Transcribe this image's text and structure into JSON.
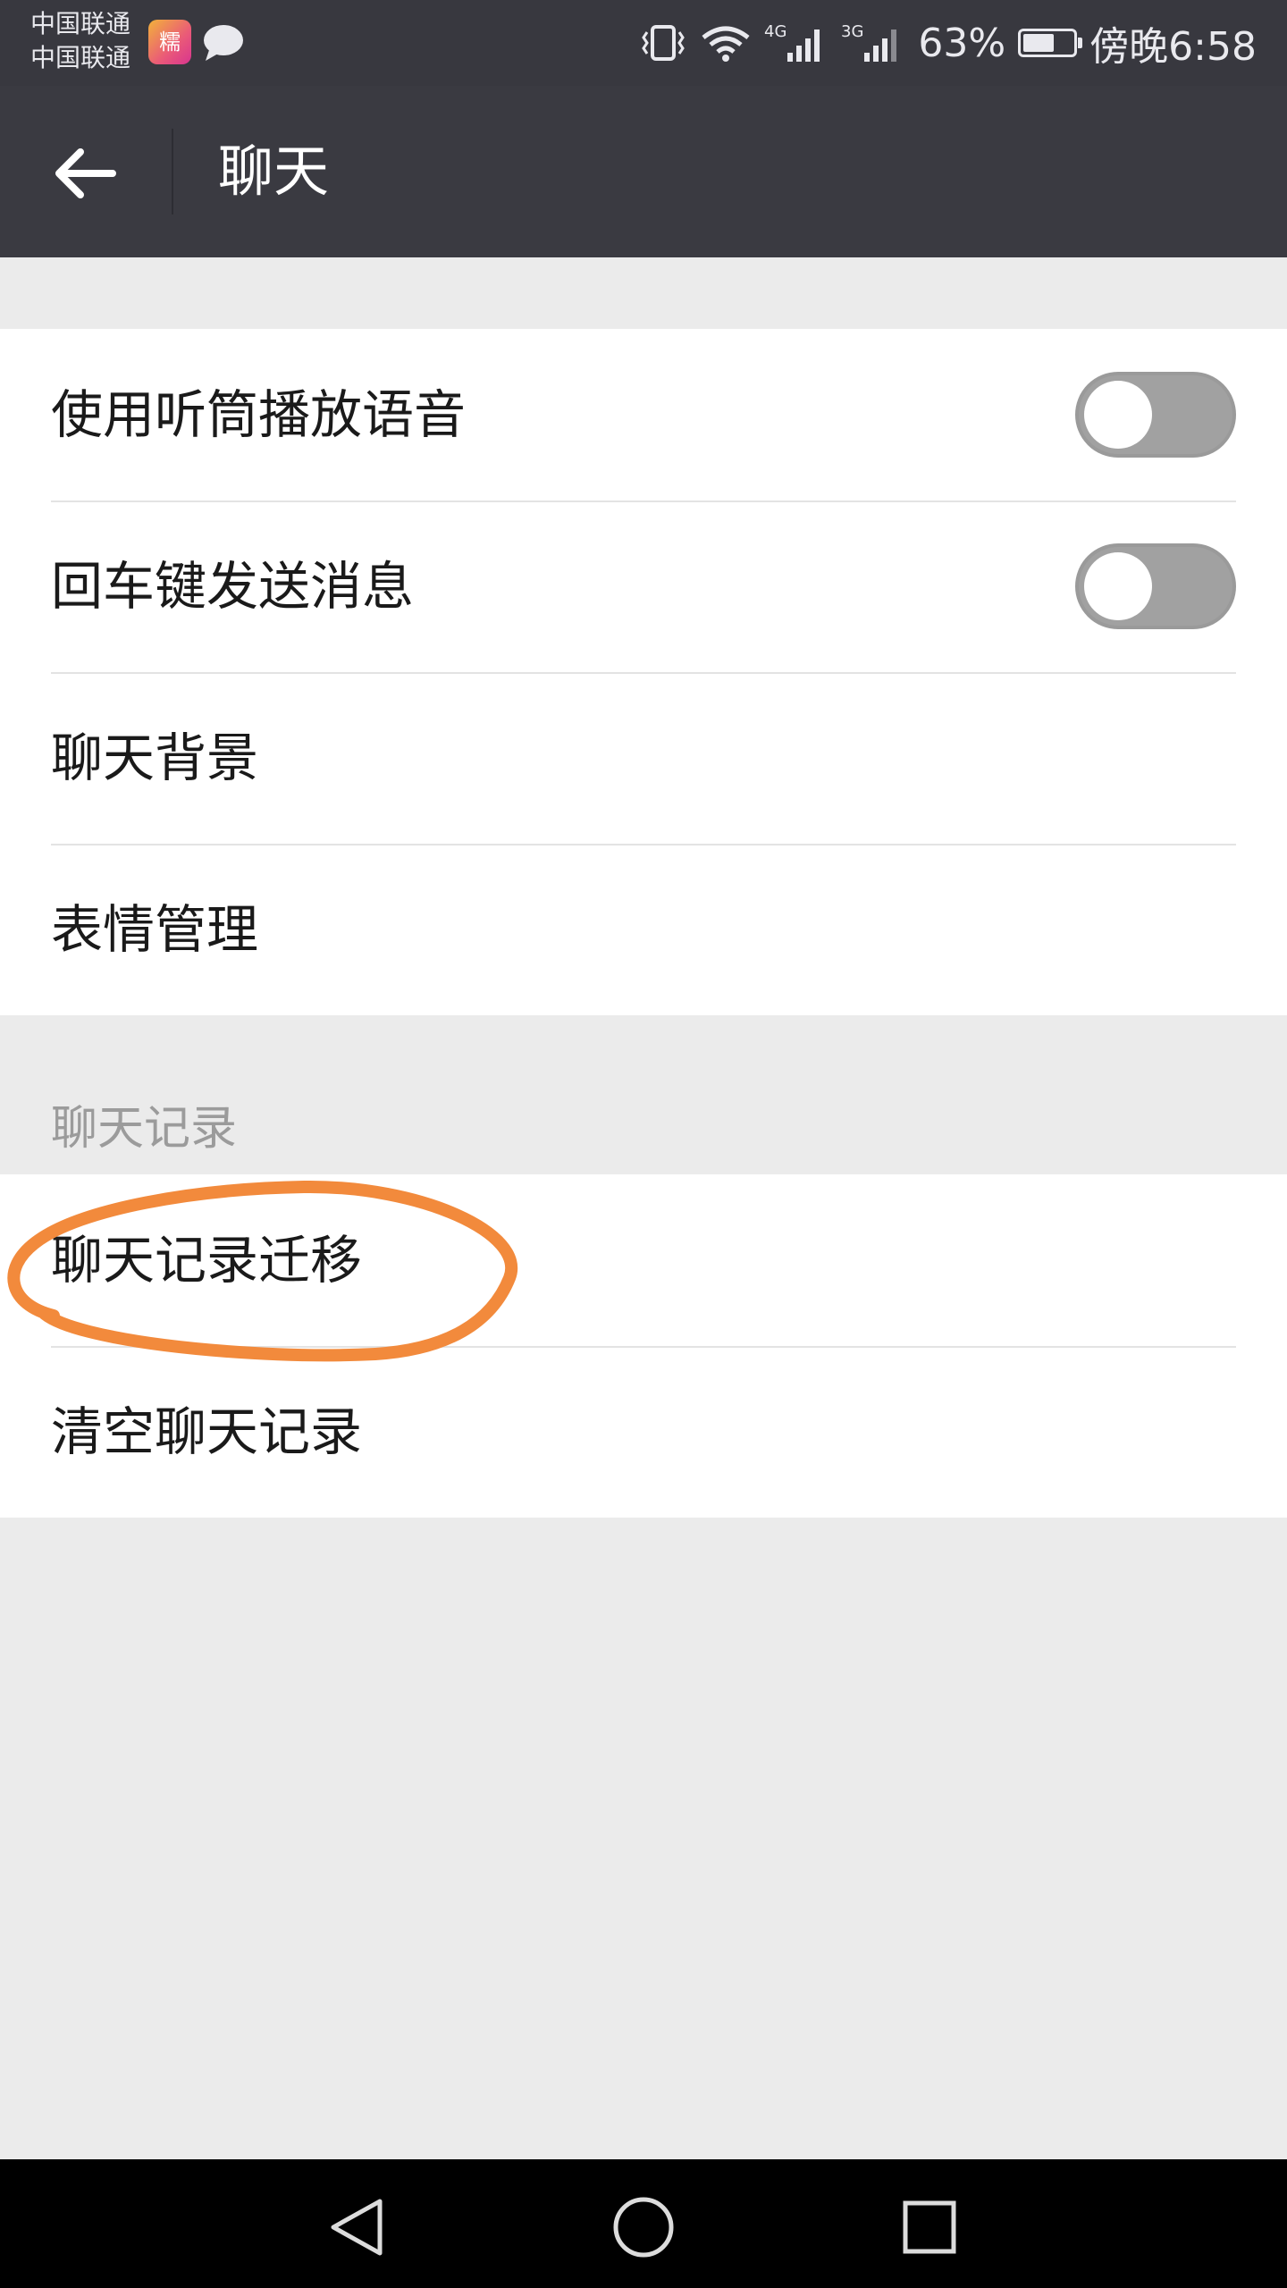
{
  "status_bar": {
    "carrier_1": "中国联通",
    "carrier_2": "中国联通",
    "app_badge_text": "糯",
    "network_1": "4G",
    "network_2": "3G",
    "battery_percent": "63%",
    "battery_level": 0.63,
    "time": "傍晚6:58"
  },
  "nav": {
    "title": "聊天",
    "back_icon": "arrow-left-icon"
  },
  "settings": {
    "use_earpiece": {
      "label": "使用听筒播放语音",
      "enabled": false
    },
    "enter_to_send": {
      "label": "回车键发送消息",
      "enabled": false
    },
    "chat_background": {
      "label": "聊天背景"
    },
    "sticker_management": {
      "label": "表情管理"
    }
  },
  "chat_history": {
    "section_title": "聊天记录",
    "migrate": {
      "label": "聊天记录迁移"
    },
    "clear": {
      "label": "清空聊天记录"
    }
  },
  "annotation": {
    "color": "#f28a3c"
  },
  "system_nav": {
    "back_icon": "triangle-back-icon",
    "home_icon": "circle-home-icon",
    "recents_icon": "square-recents-icon"
  }
}
